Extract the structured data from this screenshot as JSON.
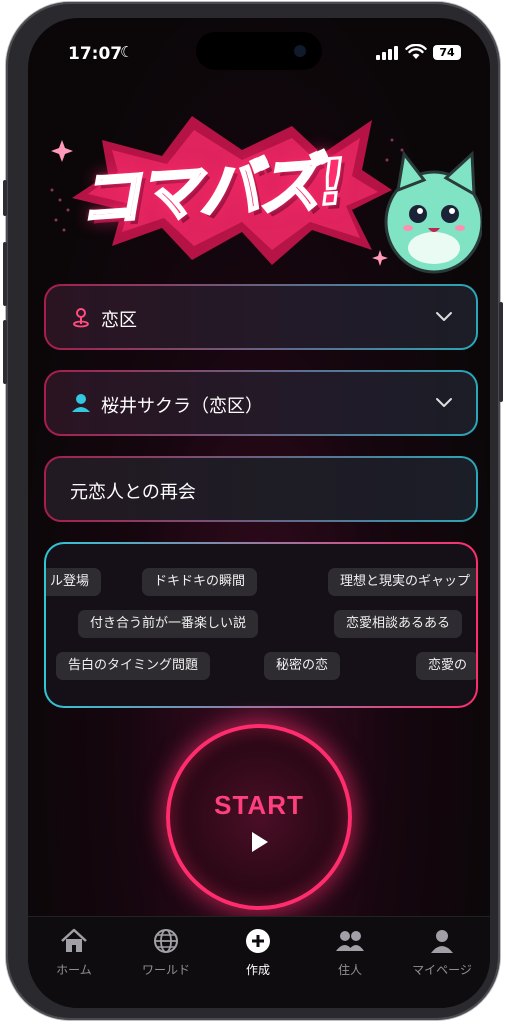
{
  "status_bar": {
    "time": "17:07",
    "battery": "74"
  },
  "logo": {
    "text": "コマバズ!"
  },
  "fields": {
    "area": {
      "label": "恋区"
    },
    "character": {
      "label": "桜井サクラ（恋区）"
    },
    "topic": {
      "label": "元恋人との再会"
    }
  },
  "tags": [
    "ル登場",
    "ドキドキの瞬間",
    "理想と現実のギャップ",
    "付き合う前が一番楽しい説",
    "恋愛相談あるある",
    "告白のタイミング問題",
    "秘密の恋",
    "恋愛の"
  ],
  "start_button": {
    "label": "START"
  },
  "tabbar": {
    "items": [
      {
        "label": "ホーム",
        "icon": "home-icon"
      },
      {
        "label": "ワールド",
        "icon": "globe-icon"
      },
      {
        "label": "作成",
        "icon": "plus-circle-icon"
      },
      {
        "label": "住人",
        "icon": "people-icon"
      },
      {
        "label": "マイページ",
        "icon": "person-icon"
      }
    ],
    "active_index": 2
  },
  "colors": {
    "accent_pink": "#ff2d6e",
    "accent_cyan": "#2fc6d6",
    "background": "#0b0709"
  }
}
